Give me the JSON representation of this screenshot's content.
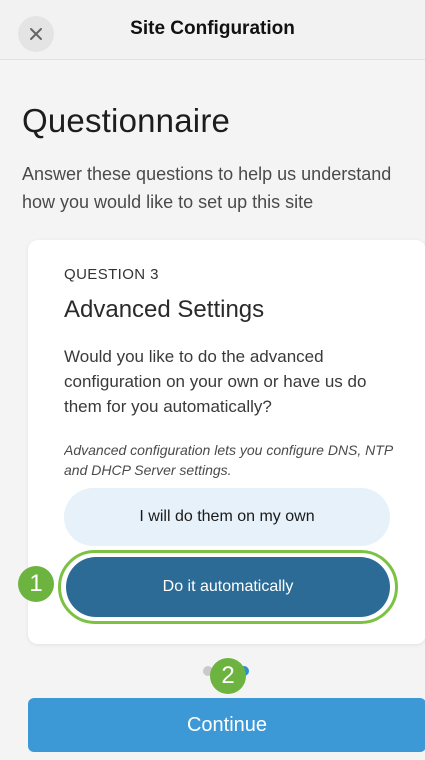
{
  "header": {
    "title": "Site Configuration",
    "close_icon": "close-icon"
  },
  "page": {
    "title": "Questionnaire",
    "subtitle": "Answer these questions to help us understand how you would like to set up this site"
  },
  "question": {
    "label": "QUESTION 3",
    "title": "Advanced Settings",
    "description": "Would you like to do the advanced configuration on your own or have us do them for you automatically?",
    "note": "Advanced configuration lets you configure DNS, NTP and DHCP Server settings.",
    "options": [
      {
        "label": "I will do them on my own",
        "selected": false
      },
      {
        "label": "Do it automatically",
        "selected": true
      }
    ]
  },
  "annotations": {
    "marker_1": "1",
    "marker_2": "2",
    "highlight_color": "#7cc242"
  },
  "footer": {
    "continue_label": "Continue"
  },
  "colors": {
    "primary": "#3d99d6",
    "selected_option": "#2b6b96",
    "unselected_option": "#e6f1f9"
  }
}
